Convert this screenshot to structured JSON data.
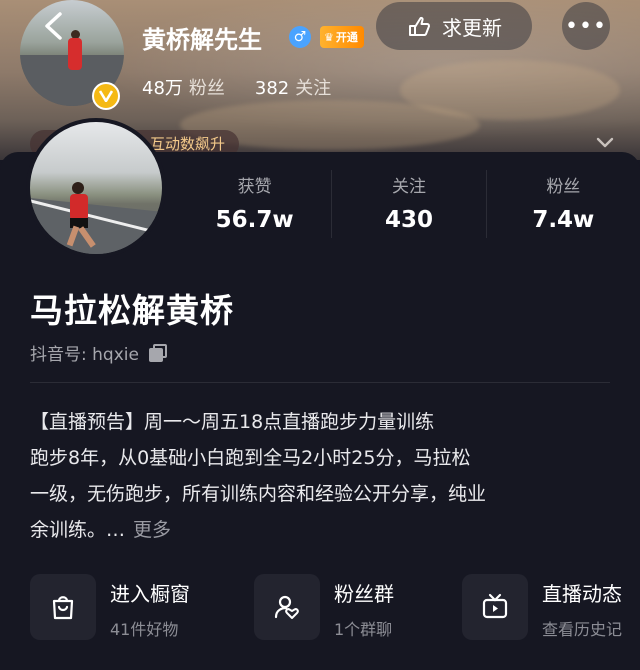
{
  "header": {
    "back_icon": "chevron-left-icon",
    "name": "黄桥解先生",
    "gender_icon": "male-icon",
    "vip_label": "开通",
    "followers_count": "48万",
    "followers_label": "粉丝",
    "following_count": "382",
    "following_label": "关注",
    "update_button": "求更新",
    "more_icon": "more-icon",
    "promo_text": "互动数飙升",
    "collapse_icon": "chevron-down-icon"
  },
  "profile": {
    "nickname": "马拉松解黄桥",
    "douyin_id": "抖音号: hqxie",
    "stats": [
      {
        "label": "获赞",
        "value": "56.7w"
      },
      {
        "label": "关注",
        "value": "430"
      },
      {
        "label": "粉丝",
        "value": "7.4w"
      }
    ],
    "bio_lines": [
      "【直播预告】周一～周五18点直播跑步力量训练",
      "跑步8年，从0基础小白跑到全马2小时25分，马拉松",
      "一级，无伤跑步，所有训练内容和经验公开分享，纯业",
      "余训练。…"
    ],
    "bio_more": "更多"
  },
  "entries": [
    {
      "title": "进入橱窗",
      "subtitle": "41件好物",
      "icon": "shopping-bag-icon"
    },
    {
      "title": "粉丝群",
      "subtitle": "1个群聊",
      "icon": "fan-group-icon"
    },
    {
      "title": "直播动态",
      "subtitle": "查看历史记",
      "icon": "live-tv-icon"
    }
  ],
  "colors": {
    "background": "#161722",
    "accent_gold": "#f5b914",
    "vip_orange": "#ff8a00",
    "male_blue": "#4aa3ff"
  }
}
